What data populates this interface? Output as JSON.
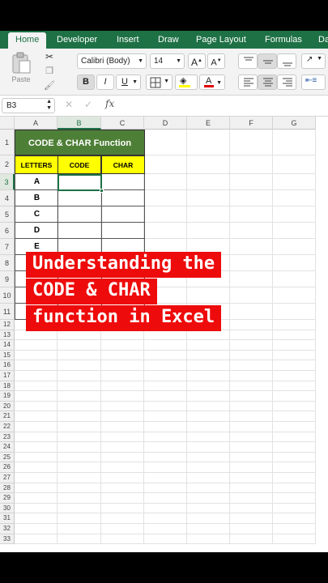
{
  "ribbon_tabs": [
    "Home",
    "Developer",
    "Insert",
    "Draw",
    "Page Layout",
    "Formulas",
    "Da"
  ],
  "ribbon": {
    "paste_label": "Paste",
    "font_name": "Calibri (Body)",
    "font_size": "14",
    "grow_label": "A",
    "shrink_label": "A",
    "bold": "B",
    "italic": "I",
    "underline": "U",
    "font_color_label": "A",
    "accent_color": "#1e7145"
  },
  "formula_bar": {
    "name_box": "B3",
    "cancel_icon": "✕",
    "enter_icon": "✓",
    "fx_label": "fx",
    "formula": ""
  },
  "columns": [
    "A",
    "B",
    "C",
    "D",
    "E",
    "F",
    "G"
  ],
  "rows": [
    "1",
    "2",
    "3",
    "4",
    "5",
    "6",
    "7",
    "8",
    "9",
    "10",
    "11",
    "12",
    "13",
    "14",
    "15",
    "16",
    "17",
    "18",
    "19",
    "20",
    "21",
    "22",
    "23",
    "24",
    "25",
    "26",
    "27",
    "28",
    "29",
    "30",
    "31",
    "32",
    "33"
  ],
  "table": {
    "title": "CODE & CHAR Function",
    "headers": [
      "LETTERS",
      "CODE",
      "CHAR"
    ],
    "letters": [
      "A",
      "B",
      "C",
      "D",
      "E"
    ],
    "title_color": "#4e7f37",
    "header_color": "#ffff00"
  },
  "overlay": {
    "lines": [
      "Understanding the",
      "CODE & CHAR",
      "function in Excel"
    ],
    "color": "#ee0b0b"
  }
}
